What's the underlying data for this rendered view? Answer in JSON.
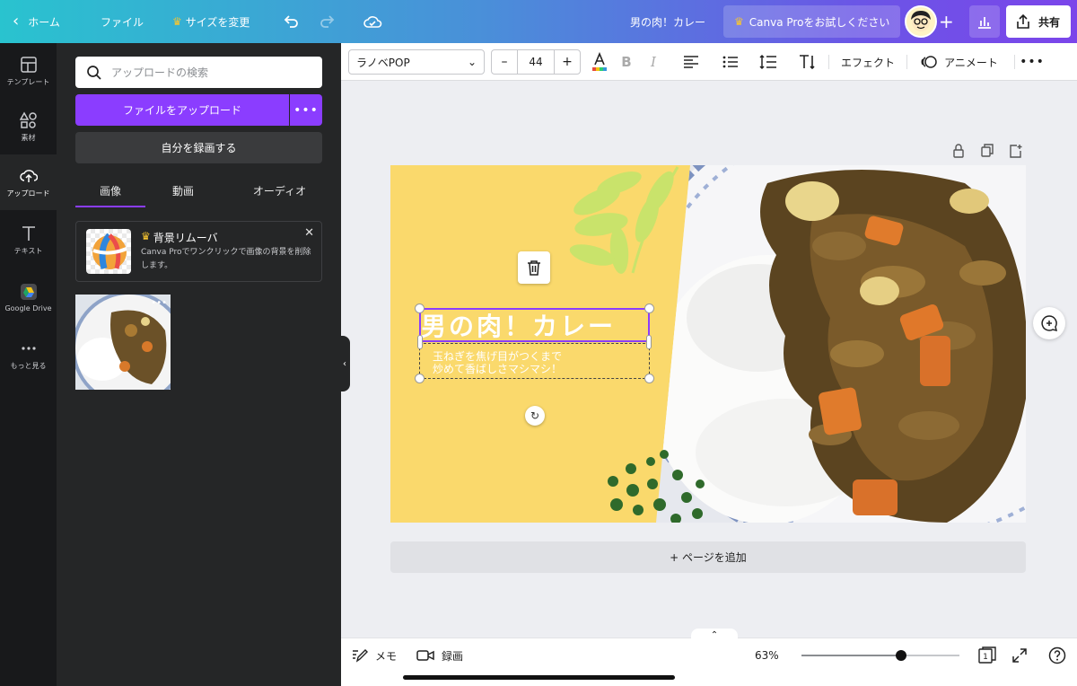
{
  "topbar": {
    "home_label": "ホーム",
    "file_label": "ファイル",
    "resize_label": "サイズを変更",
    "doc_title": "男の肉！カレー",
    "pro_label": "Canva Proをお試しください",
    "share_label": "共有"
  },
  "rail": {
    "items": [
      {
        "label": "テンプレート",
        "icon": "template-icon"
      },
      {
        "label": "素材",
        "icon": "elements-icon"
      },
      {
        "label": "アップロード",
        "icon": "upload-icon"
      },
      {
        "label": "テキスト",
        "icon": "text-icon"
      },
      {
        "label": "Google Drive",
        "icon": "google-drive-icon"
      },
      {
        "label": "もっと見る",
        "icon": "more-icon"
      }
    ]
  },
  "panel": {
    "search_placeholder": "アップロードの検索",
    "upload_button": "ファイルをアップロード",
    "record_button": "自分を録画する",
    "tabs": [
      "画像",
      "動画",
      "オーディオ"
    ],
    "promo": {
      "title": "背景リムーバ",
      "desc": "Canva Proでワンクリックで画像の背景を削除します。"
    }
  },
  "toolbar": {
    "font": "ラノベPOP",
    "font_size": "44",
    "minus": "–",
    "plus": "+",
    "effect": "エフェクト",
    "animate": "アニメート"
  },
  "canvas": {
    "title_text": "男の肉！カレー",
    "subtitle_text": "玉ねぎを焦げ目がつくまで\n炒めて香ばしさマシマシ！",
    "add_page": "+ ページを追加"
  },
  "bottom": {
    "memo": "メモ",
    "record": "録画",
    "zoom": "63%",
    "zoom_level": 0.63,
    "page_count": "1"
  },
  "colors": {
    "accent": "#8b3dff",
    "design_bg": "#fad96c",
    "leaf_light": "#c9e36b",
    "dots_green": "#2f6a2b"
  }
}
